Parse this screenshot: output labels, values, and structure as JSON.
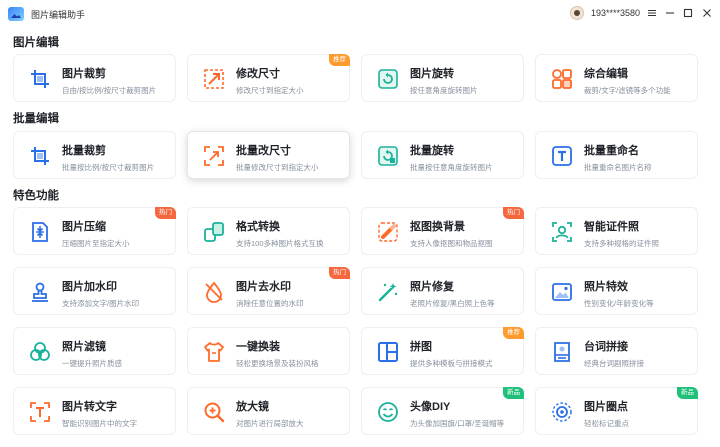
{
  "app": {
    "title": "图片编辑助手"
  },
  "user": {
    "id": "193****3580"
  },
  "colors": {
    "blue": "#2b6fe8",
    "orange": "#ff6a2a",
    "teal": "#19b29a",
    "hot": "#f5673f",
    "recommend": "#ff9a2e",
    "new": "#21c07a"
  },
  "sections": [
    {
      "title": "图片编辑"
    },
    {
      "title": "批量编辑"
    },
    {
      "title": "特色功能"
    }
  ],
  "cards": [
    {
      "title": "图片裁剪",
      "sub": "自由/按比例/按尺寸裁剪图片",
      "icon": "crop-icon",
      "badge": ""
    },
    {
      "title": "修改尺寸",
      "sub": "修改尺寸到指定大小",
      "icon": "resize-icon",
      "badge": "推荐"
    },
    {
      "title": "图片旋转",
      "sub": "按任意角度旋转图片",
      "icon": "rotate-icon",
      "badge": ""
    },
    {
      "title": "综合编辑",
      "sub": "裁剪/文字/滤镜等多个功能",
      "icon": "grid-edit-icon",
      "badge": ""
    },
    {
      "title": "批量裁剪",
      "sub": "批量按比例/按尺寸裁剪图片",
      "icon": "batch-crop-icon",
      "badge": ""
    },
    {
      "title": "批量改尺寸",
      "sub": "批量修改尺寸到指定大小",
      "icon": "batch-resize-icon",
      "badge": ""
    },
    {
      "title": "批量旋转",
      "sub": "批量按任意角度旋转图片",
      "icon": "batch-rotate-icon",
      "badge": ""
    },
    {
      "title": "批量重命名",
      "sub": "批量重命名图片名称",
      "icon": "rename-icon",
      "badge": ""
    },
    {
      "title": "图片压缩",
      "sub": "压缩图片至指定大小",
      "icon": "compress-icon",
      "badge": "热门"
    },
    {
      "title": "格式转换",
      "sub": "支持100多种图片格式互换",
      "icon": "convert-icon",
      "badge": ""
    },
    {
      "title": "抠图换背景",
      "sub": "支持人像抠图和物品抠图",
      "icon": "cutout-icon",
      "badge": "热门"
    },
    {
      "title": "智能证件照",
      "sub": "支持多种规格的证件照",
      "icon": "id-photo-icon",
      "badge": ""
    },
    {
      "title": "图片加水印",
      "sub": "支持添加文字/图片水印",
      "icon": "stamp-icon",
      "badge": ""
    },
    {
      "title": "图片去水印",
      "sub": "消除任意位置的水印",
      "icon": "remove-watermark-icon",
      "badge": "热门"
    },
    {
      "title": "照片修复",
      "sub": "老照片修复/黑白照上色等",
      "icon": "magic-wand-icon",
      "badge": ""
    },
    {
      "title": "照片特效",
      "sub": "性别变化/年龄变化等",
      "icon": "image-effect-icon",
      "badge": ""
    },
    {
      "title": "照片滤镜",
      "sub": "一键提升照片质感",
      "icon": "filter-icon",
      "badge": ""
    },
    {
      "title": "一键换装",
      "sub": "轻松更换场景及装扮风格",
      "icon": "outfit-icon",
      "badge": ""
    },
    {
      "title": "拼图",
      "sub": "提供多种模板与拼接模式",
      "icon": "collage-icon",
      "badge": "推荐"
    },
    {
      "title": "台词拼接",
      "sub": "经典台词剧照拼接",
      "icon": "caption-stitch-icon",
      "badge": ""
    },
    {
      "title": "图片转文字",
      "sub": "智能识别图片中的文字",
      "icon": "ocr-icon",
      "badge": ""
    },
    {
      "title": "放大镜",
      "sub": "对图片进行局部放大",
      "icon": "magnifier-icon",
      "badge": ""
    },
    {
      "title": "头像DIY",
      "sub": "为头像加国旗/口罩/圣诞帽等",
      "icon": "smiley-icon",
      "badge": "新品"
    },
    {
      "title": "图片圈点",
      "sub": "轻松标记重点",
      "icon": "annotate-icon",
      "badge": "新品"
    }
  ]
}
